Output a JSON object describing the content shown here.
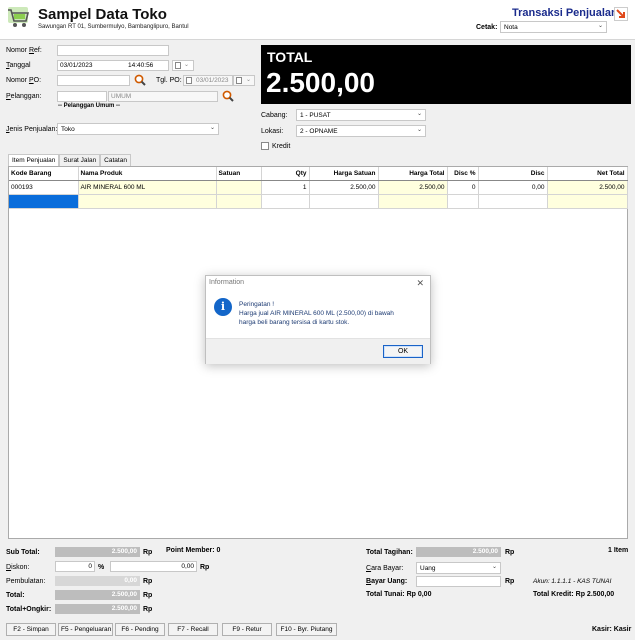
{
  "header": {
    "store_name": "Sampel Data Toko",
    "store_address": "Sawungan RT 01, Sumbermulyo, Bambanglipuro, Bantul",
    "transaction_title": "Transaksi Penjualan",
    "print_label": "Cetak:",
    "print_value": "Nota"
  },
  "form": {
    "ref_label": "Nomor Ref:",
    "ref_value": "",
    "date_label": "Tanggal",
    "date_value": "03/01/2023",
    "time_value": "14:40:56",
    "po_label": "Nomor PO:",
    "po_value": "",
    "po_date_label": "Tgl. PO:",
    "po_date_value": "03/01/2023",
    "customer_label": "Pelanggan:",
    "customer_code": "",
    "customer_type": "UMUM",
    "customer_name": "-- Pelanggan Umum --",
    "sale_type_label": "Jenis Penjualan:",
    "sale_type_value": "Toko",
    "branch_label": "Cabang:",
    "branch_value": "1 - PUSAT",
    "location_label": "Lokasi:",
    "location_value": "2 - OPNAME",
    "credit_label": "Kredit"
  },
  "total": {
    "label": "TOTAL",
    "value": "2.500,00"
  },
  "tabs": [
    "Item Penjualan",
    "Surat Jalan",
    "Catatan"
  ],
  "grid": {
    "columns": [
      "Kode Barang",
      "Nama Produk",
      "Satuan",
      "Qty",
      "Harga Satuan",
      "Harga Total",
      "Disc %",
      "Disc",
      "Net Total"
    ],
    "rows": [
      {
        "code": "000193",
        "name": "AIR MINERAL 600 ML",
        "unit": "",
        "qty": "1",
        "price": "2.500,00",
        "total": "2.500,00",
        "disc_pct": "0",
        "disc": "0,00",
        "net": "2.500,00"
      }
    ]
  },
  "dialog": {
    "title": "Information",
    "icon": "info-icon",
    "line1": "Peringatan !",
    "line2": "Harga jual AIR MINERAL 600 ML (2.500,00) di bawah",
    "line3": "harga beli barang tersisa di kartu stok.",
    "ok_label": "OK"
  },
  "summary": {
    "subtotal_label": "Sub Total:",
    "subtotal_value": "2.500,00",
    "point_label": "Point Member: 0",
    "discount_label": "Diskon:",
    "discount_pct": "0",
    "pct_sign": "%",
    "discount_value": "0,00",
    "rounding_label": "Pembulatan:",
    "rounding_value": "0,00",
    "total_label": "Total:",
    "total_value": "2.500,00",
    "total_shipping_label": "Total+Ongkir:",
    "total_shipping_value": "2.500,00",
    "currency": "Rp",
    "bill_label": "Total Tagihan:",
    "bill_value": "2.500,00",
    "pay_method_label": "Cara Bayar:",
    "pay_method_value": "Uang",
    "pay_amount_label": "Bayar Uang:",
    "pay_amount_value": "",
    "account_text": "Akun: 1.1.1.1 - KAS TUNAI",
    "cash_total_text": "Total Tunai: Rp 0,00",
    "credit_total_text": "Total Kredit: Rp 2.500,00",
    "item_count": "1 Item",
    "cashier_text": "Kasir: Kasir"
  },
  "footer_buttons": [
    "F2 - Simpan",
    "F5 - Pengeluaran",
    "F6 - Pending",
    "F7 - Recall",
    "F9 - Retur",
    "F10 - Byr. Piutang"
  ],
  "colors": {
    "title_blue": "#1a2b8c",
    "selection": "#0a6ddb",
    "row_yellow": "#ffffde"
  }
}
